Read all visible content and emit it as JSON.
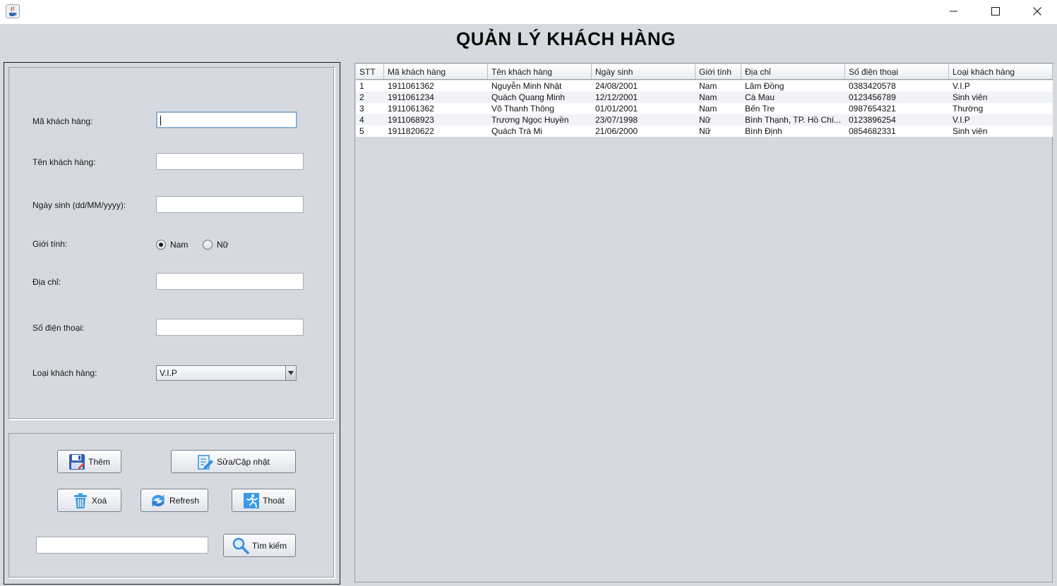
{
  "window": {
    "title": "",
    "buttons": {
      "minimize": "minimize-icon",
      "maximize": "maximize-icon",
      "close": "close-icon"
    }
  },
  "page_title": "QUẢN LÝ KHÁCH HÀNG",
  "form": {
    "ma_kh": {
      "label": "Mã khách hàng:",
      "value": ""
    },
    "ten_kh": {
      "label": "Tên khách hàng:",
      "value": ""
    },
    "ngay_sinh": {
      "label": "Ngày sinh (dd/MM/yyyy):",
      "value": ""
    },
    "gioi_tinh": {
      "label": "Giới tính:",
      "options": [
        "Nam",
        "Nữ"
      ],
      "selected": "Nam"
    },
    "dia_chi": {
      "label": "Địa chỉ:",
      "value": ""
    },
    "so_dt": {
      "label": "Số điện thoại:",
      "value": ""
    },
    "loai_kh": {
      "label": "Loại khách hàng:",
      "selected": "V.I.P"
    }
  },
  "actions": {
    "them": "Thêm",
    "sua": "Sửa/Cập nhật",
    "xoa": "Xoá",
    "refresh": "Refresh",
    "thoat": "Thoát",
    "tim_kiem": "Tìm kiếm",
    "search_value": ""
  },
  "colors": {
    "background": "#d6d9df",
    "icon_blue": "#2f8fe0",
    "accent_dark": "#1b3f8a"
  },
  "table": {
    "columns": [
      "STT",
      "Mã khách hàng",
      "Tên khách hàng",
      "Ngày sinh",
      "Giới tính",
      "Địa chỉ",
      "Số điện thoại",
      "Loại khách hàng"
    ],
    "rows": [
      [
        "1",
        "1911061362",
        "Nguyễn Minh Nhật",
        "24/08/2001",
        "Nam",
        "Lâm Đồng",
        "0383420578",
        "V.I.P"
      ],
      [
        "2",
        "1911061234",
        "Quách Quang Minh",
        "12/12/2001",
        "Nam",
        "Cà Mau",
        "0123456789",
        "Sinh viên"
      ],
      [
        "3",
        "1911061362",
        "Võ Thanh Thông",
        "01/01/2001",
        "Nam",
        "Bến Tre",
        "0987654321",
        "Thường"
      ],
      [
        "4",
        "1911068923",
        "Trương Ngọc Huyền",
        "23/07/1998",
        "Nữ",
        "Bình Thạnh, TP. Hồ Chí...",
        "0123896254",
        "V.I.P"
      ],
      [
        "5",
        "1911820622",
        "Quách Trà Mi",
        "21/06/2000",
        "Nữ",
        "Bình Định",
        "0854682331",
        "Sinh viên"
      ]
    ]
  }
}
